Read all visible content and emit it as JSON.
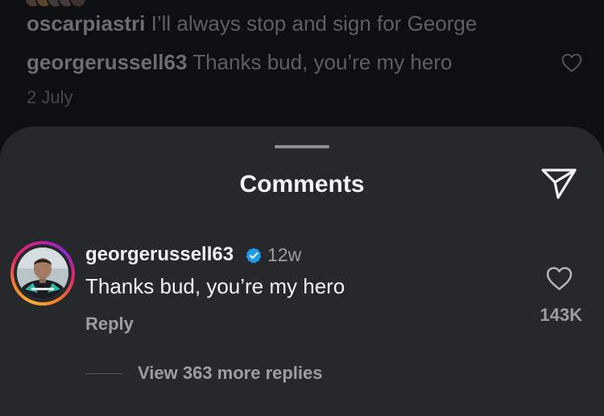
{
  "background_post": {
    "caption_username": "oscarpiastri",
    "caption_text": "I’ll always stop and sign for George",
    "reply_username": "georgerussell63",
    "reply_text": "Thanks bud, you’re my hero",
    "date": "2 July",
    "like_icon": "heart-outline-icon"
  },
  "sheet": {
    "title": "Comments",
    "share_icon": "send-icon"
  },
  "comment": {
    "username": "georgerussell63",
    "verified_icon": "verified-badge-icon",
    "verified_color": "#1d9bf0",
    "time_ago": "12w",
    "text": "Thanks bud, you’re my hero",
    "reply_label": "Reply",
    "like_icon": "heart-outline-icon",
    "like_count": "143K",
    "view_replies_label": "View 363 more replies"
  },
  "colors": {
    "sheet_background": "#26282c",
    "text_primary": "#f2f2f2",
    "text_secondary": "#9c9ea3",
    "story_ring": [
      "#f9b233",
      "#f5792a",
      "#e0266b",
      "#c51f9b",
      "#8f2bd4"
    ]
  }
}
